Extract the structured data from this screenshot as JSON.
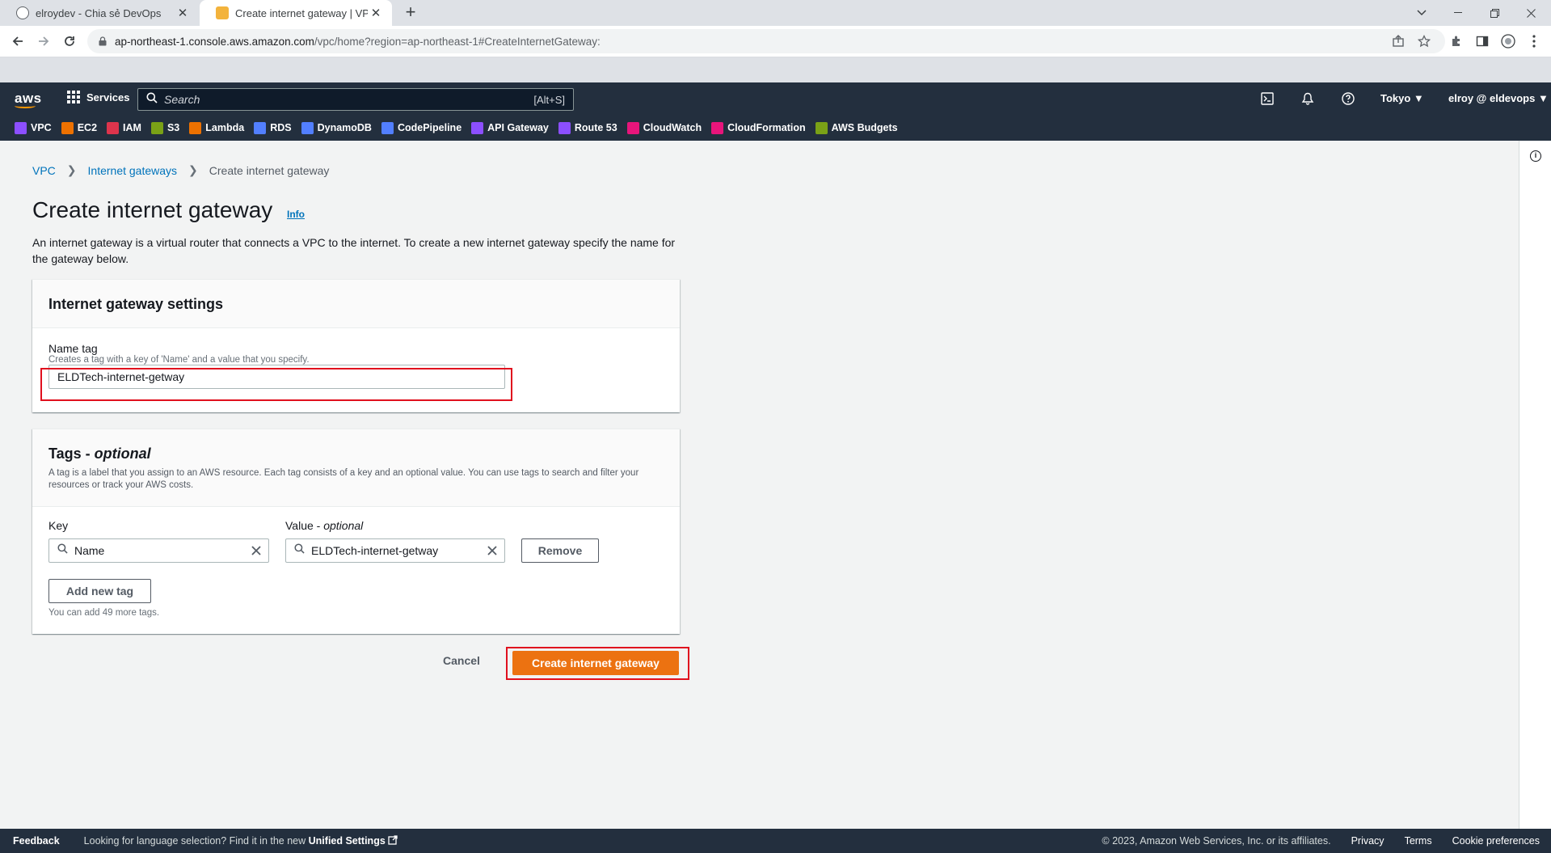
{
  "browser": {
    "tabs": [
      {
        "title": "elroydev - Chia sẻ DevOps",
        "active": false
      },
      {
        "title": "Create internet gateway | VPC Ma",
        "active": true
      }
    ],
    "url_host": "ap-northeast-1.console.aws.amazon.com",
    "url_path": "/vpc/home?region=ap-northeast-1#CreateInternetGateway:"
  },
  "aws_nav": {
    "logo": "aws",
    "services_label": "Services",
    "search_placeholder": "Search",
    "search_shortcut": "[Alt+S]",
    "region": "Tokyo ▼",
    "account": "elroy @ eldevops ▼",
    "favorites": [
      {
        "label": "VPC",
        "color": "#8c4fff"
      },
      {
        "label": "EC2",
        "color": "#ed7100"
      },
      {
        "label": "IAM",
        "color": "#dd344c"
      },
      {
        "label": "S3",
        "color": "#7aa116"
      },
      {
        "label": "Lambda",
        "color": "#ed7100"
      },
      {
        "label": "RDS",
        "color": "#527fff"
      },
      {
        "label": "DynamoDB",
        "color": "#527fff"
      },
      {
        "label": "CodePipeline",
        "color": "#527fff"
      },
      {
        "label": "API Gateway",
        "color": "#8c4fff"
      },
      {
        "label": "Route 53",
        "color": "#8c4fff"
      },
      {
        "label": "CloudWatch",
        "color": "#e7157b"
      },
      {
        "label": "CloudFormation",
        "color": "#e7157b"
      },
      {
        "label": "AWS Budgets",
        "color": "#7aa116"
      }
    ]
  },
  "breadcrumb": {
    "vpc": "VPC",
    "internet_gateways": "Internet gateways",
    "current": "Create internet gateway"
  },
  "page": {
    "title": "Create internet gateway",
    "info": "Info",
    "description": "An internet gateway is a virtual router that connects a VPC to the internet. To create a new internet gateway specify the name for the gateway below."
  },
  "settings": {
    "heading": "Internet gateway settings",
    "name_tag_label": "Name tag",
    "name_tag_hint": "Creates a tag with a key of 'Name' and a value that you specify.",
    "name_tag_value": "ELDTech-internet-getway"
  },
  "tags": {
    "heading": "Tags - ",
    "heading_optional": "optional",
    "description": "A tag is a label that you assign to an AWS resource. Each tag consists of a key and an optional value. You can use tags to search and filter your resources or track your AWS costs.",
    "key_label": "Key",
    "value_label": "Value - ",
    "value_label_optional": "optional",
    "key_value": "Name",
    "value_value": "ELDTech-internet-getway",
    "remove_label": "Remove",
    "add_label": "Add new tag",
    "limit_hint": "You can add 49 more tags."
  },
  "actions": {
    "cancel": "Cancel",
    "create": "Create internet gateway"
  },
  "footer": {
    "feedback": "Feedback",
    "lang_prefix": "Looking for language selection? Find it in the new ",
    "lang_link": "Unified Settings",
    "copyright": "© 2023, Amazon Web Services, Inc. or its affiliates.",
    "privacy": "Privacy",
    "terms": "Terms",
    "cookies": "Cookie preferences"
  }
}
